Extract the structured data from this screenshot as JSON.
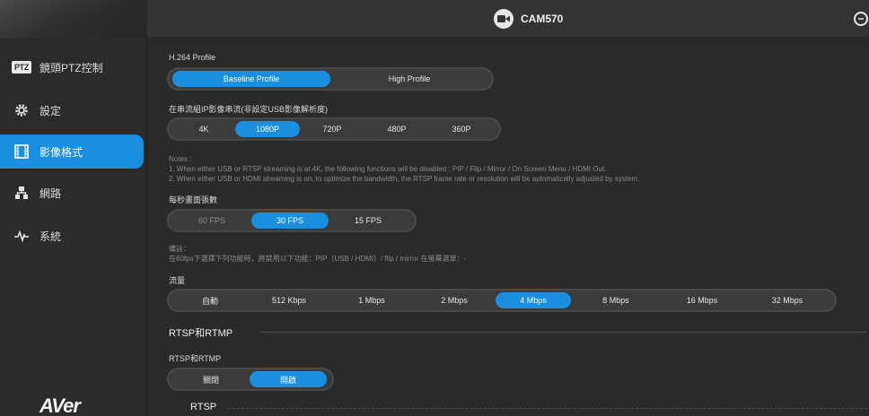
{
  "app": {
    "title": "CAM570",
    "logo": "AVer"
  },
  "sidebar": {
    "items": [
      {
        "label": "鏡頭PTZ控制",
        "badge": "PTZ"
      },
      {
        "label": "設定"
      },
      {
        "label": "影像格式"
      },
      {
        "label": "網路"
      },
      {
        "label": "系統"
      }
    ]
  },
  "profile": {
    "label": "H.264 Profile",
    "options": [
      "Baseline Profile",
      "High Profile"
    ],
    "selected": "Baseline Profile"
  },
  "resolution": {
    "label": "在串流組IP影像串流(非設定USB影像解析度)",
    "options": [
      "4K",
      "1080P",
      "720P",
      "480P",
      "360P"
    ],
    "selected": "1080P"
  },
  "notes": {
    "title": "Notes :",
    "line1": "1. When either USB or RTSP streaming is at 4K, the following functions will be disabled : PIP / Flip / Mirror / On Screen Menu / HDMI Out.",
    "line2": "2. When either USB or HDMI streaming is on, to optimize the bandwidth, the RTSP frame rate or resolution will be automatically adjusted by system."
  },
  "fps": {
    "label": "每秒畫面張數",
    "options": [
      "60 FPS",
      "30 FPS",
      "15 FPS"
    ],
    "selected": "30 FPS"
  },
  "fps_note": {
    "title": "備註：",
    "line1": "在60fps下選擇下列功能時，將禁用以下功能：PIP（USB / HDMI）/ flip / mirror 在螢幕選單：-"
  },
  "bitrate": {
    "label": "流量",
    "options": [
      "自動",
      "512 Kbps",
      "1 Mbps",
      "2 Mbps",
      "4 Mbps",
      "8 Mbps",
      "16 Mbps",
      "32 Mbps"
    ],
    "selected": "4 Mbps"
  },
  "rtsp_section": {
    "title": "RTSP和RTMP"
  },
  "rtsp_toggle": {
    "label": "RTSP和RTMP",
    "options": [
      "關閉",
      "開啟"
    ],
    "selected": "開啟"
  },
  "rtsp_sub": {
    "title": "RTSP"
  },
  "colors": {
    "accent": "#1a8fe0",
    "bg": "#2a2a2a",
    "sidebar": "#2b2b2b"
  }
}
